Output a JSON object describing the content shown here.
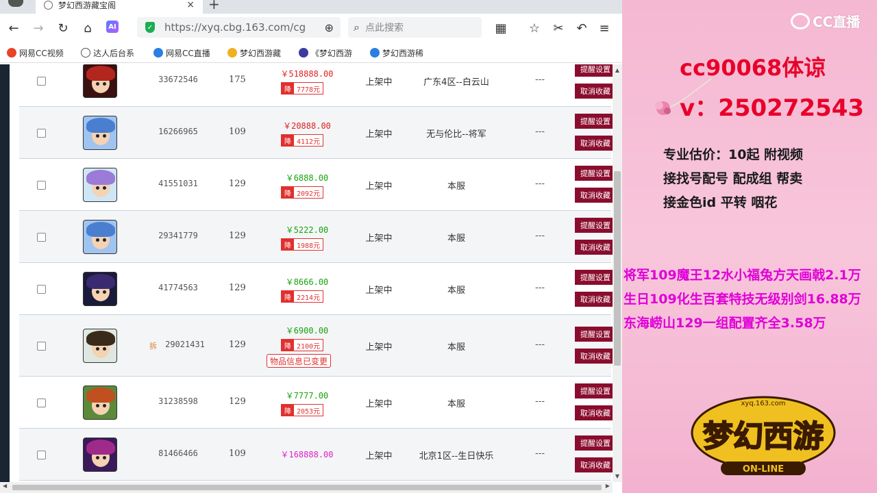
{
  "browser": {
    "tab_title": "梦幻西游藏宝阁",
    "tab_close": "×",
    "new_tab": "+",
    "url": "https://xyq.cbg.163.com/cg",
    "ai_label": "AI",
    "search_placeholder": "点此搜索",
    "bookmarks": [
      "网易CC视频",
      "达人后台系",
      "网易CC直播",
      "梦幻西游藏",
      "《梦幻西游",
      "梦幻西游稀"
    ]
  },
  "listings": [
    {
      "serial": "33672546",
      "level": "175",
      "price": "￥518888.00",
      "price_color": "#e02020",
      "drop": "7778元",
      "status": "上架中",
      "server": "广东4区--白云山",
      "extra": "---",
      "btn1": "提醒设置",
      "btn2": "取消收藏",
      "tag": "",
      "changed": "",
      "avatar": {
        "hair": "#b3261e",
        "bg": "#3a1010"
      }
    },
    {
      "serial": "16266965",
      "level": "109",
      "price": "￥20888.00",
      "price_color": "#e02020",
      "drop": "4112元",
      "status": "上架中",
      "server": "无与伦比--将军",
      "extra": "---",
      "btn1": "提醒设置",
      "btn2": "取消收藏",
      "tag": "",
      "changed": "",
      "avatar": {
        "hair": "#4a7fd0",
        "bg": "#9fc4f0"
      }
    },
    {
      "serial": "41551031",
      "level": "129",
      "price": "￥6888.00",
      "price_color": "#16a30a",
      "drop": "2092元",
      "status": "上架中",
      "server": "本服",
      "extra": "---",
      "btn1": "提醒设置",
      "btn2": "取消收藏",
      "tag": "",
      "changed": "",
      "avatar": {
        "hair": "#9c7ad8",
        "bg": "#cfe6f5"
      }
    },
    {
      "serial": "29341779",
      "level": "129",
      "price": "￥5222.00",
      "price_color": "#16a30a",
      "drop": "1988元",
      "status": "上架中",
      "server": "本服",
      "extra": "---",
      "btn1": "提醒设置",
      "btn2": "取消收藏",
      "tag": "",
      "changed": "",
      "avatar": {
        "hair": "#4a7fd0",
        "bg": "#9fc4f0"
      }
    },
    {
      "serial": "41774563",
      "level": "129",
      "price": "￥8666.00",
      "price_color": "#16a30a",
      "drop": "2214元",
      "status": "上架中",
      "server": "本服",
      "extra": "---",
      "btn1": "提醒设置",
      "btn2": "取消收藏",
      "tag": "",
      "changed": "",
      "avatar": {
        "hair": "#3a2a70",
        "bg": "#1a1a3a"
      }
    },
    {
      "serial": "29021431",
      "level": "129",
      "price": "￥6900.00",
      "price_color": "#16a30a",
      "drop": "2100元",
      "status": "上架中",
      "server": "本服",
      "extra": "---",
      "btn1": "提醒设置",
      "btn2": "取消收藏",
      "tag": "拆",
      "changed": "物品信息已变更",
      "avatar": {
        "hair": "#3a2a1a",
        "bg": "#dfe8e0"
      }
    },
    {
      "serial": "31238598",
      "level": "129",
      "price": "￥7777.00",
      "price_color": "#16a30a",
      "drop": "2053元",
      "status": "上架中",
      "server": "本服",
      "extra": "---",
      "btn1": "提醒设置",
      "btn2": "取消收藏",
      "tag": "",
      "changed": "",
      "avatar": {
        "hair": "#c05020",
        "bg": "#5a8a3a"
      }
    },
    {
      "serial": "81466466",
      "level": "109",
      "price": "￥168888.00",
      "price_color": "#e020c8",
      "drop": "",
      "status": "上架中",
      "server": "北京1区--生日快乐",
      "extra": "---",
      "btn1": "提醒设置",
      "btn2": "取消收藏",
      "tag": "",
      "changed": "",
      "avatar": {
        "hair": "#a02a8a",
        "bg": "#3a1a5a"
      }
    }
  ],
  "drop_label": "降",
  "overlay": {
    "platform": "CC直播",
    "streamer_line": "cc90068体谅",
    "contact_line": "v：250272543",
    "services": [
      "专业估价：10起  附视频",
      "接找号配号 配成组 帮卖",
      "接金色id 平转 咽花"
    ],
    "deals": [
      "将军109魔王12水小福兔方天画戟2.1万",
      "生日109化生百套特技无级别剑16.88万",
      "东海崂山129一组配置齐全3.58万"
    ],
    "game_logo_text": "梦幻西游",
    "game_logo_sub": "ON-LINE",
    "game_logo_small": "xyq.163.com"
  }
}
